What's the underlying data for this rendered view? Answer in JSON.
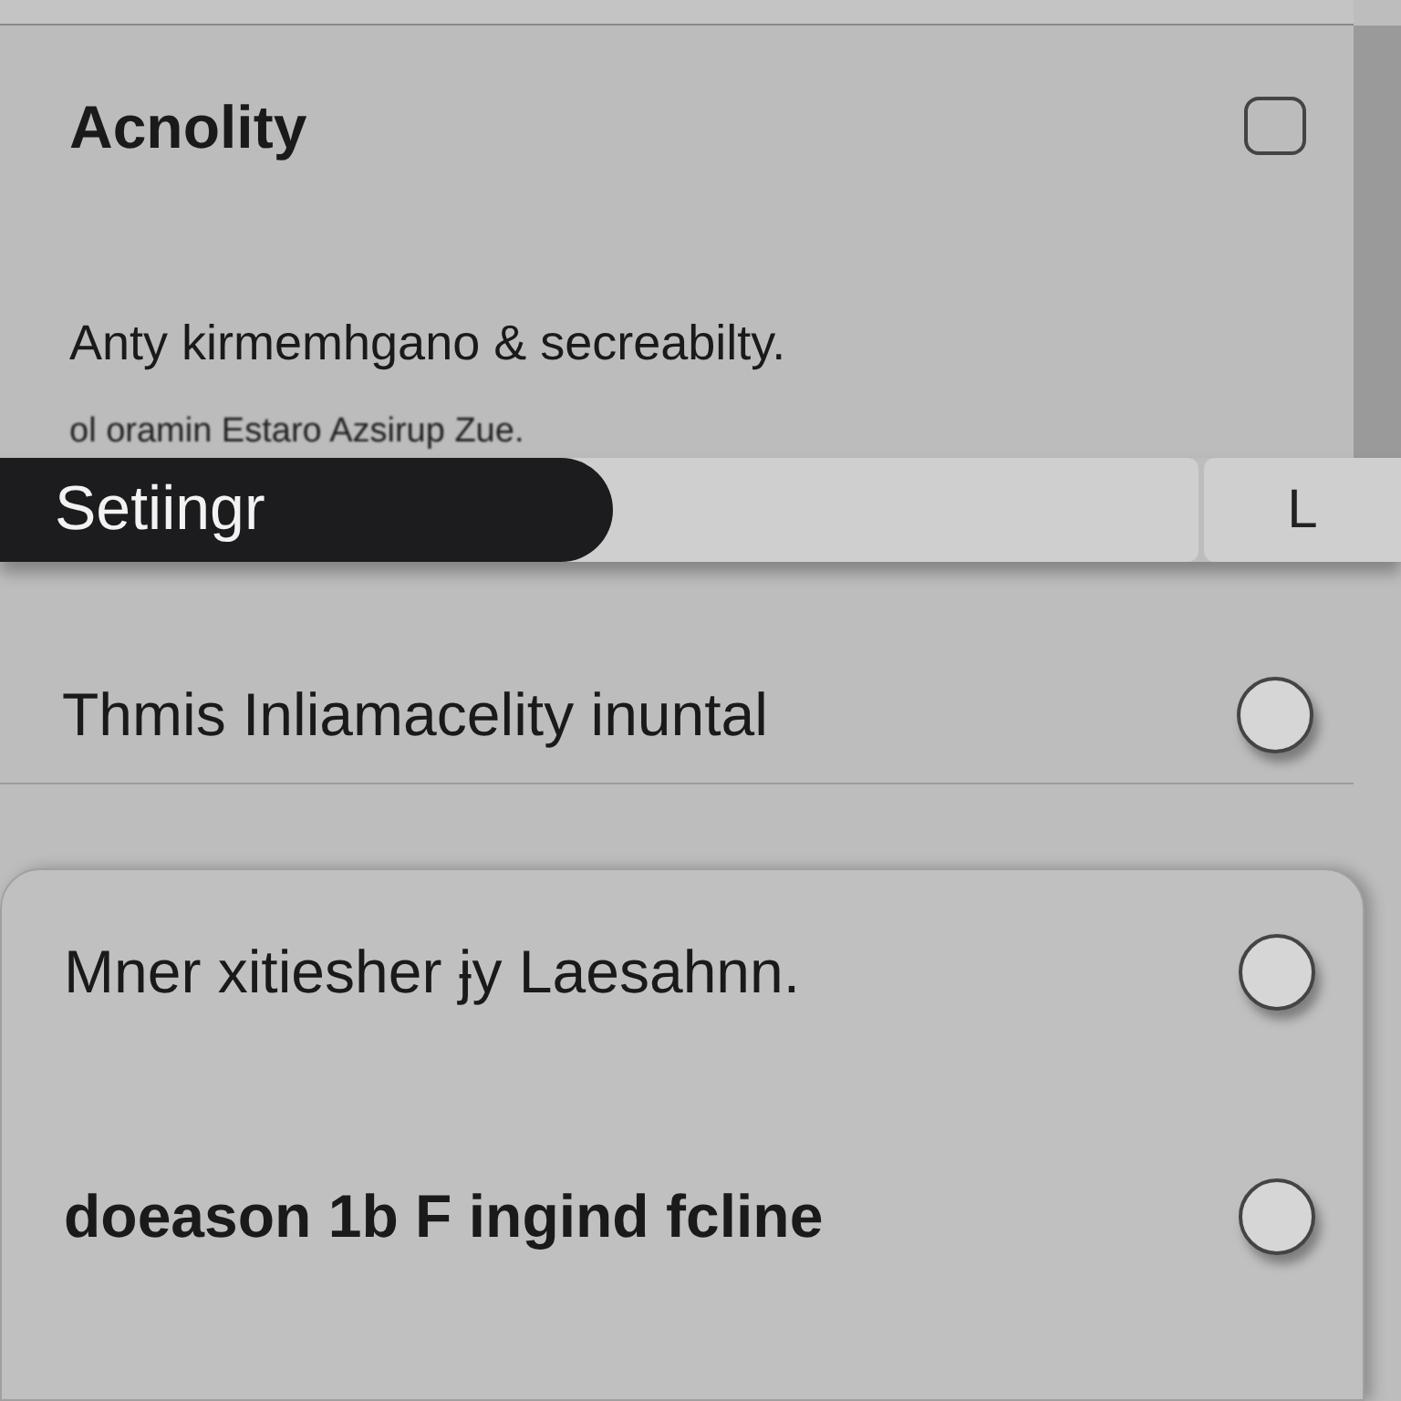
{
  "card": {
    "title": "Acnolity",
    "checked": false,
    "body": "Anty kirmemhgano & secreabilty.",
    "note": "ol oramin Estaro Azsirup Zue."
  },
  "toolbar": {
    "primary": "Setiingr",
    "secondary": "L"
  },
  "rows": [
    {
      "label": "Thmis Inliamacelity inuntal",
      "bold": false,
      "selected": false
    }
  ],
  "options": [
    {
      "label": "Mner xitiesher  ɉy Laesahnn.",
      "bold": false,
      "selected": false
    },
    {
      "label": "doeason 1b F ingind fcline",
      "bold": true,
      "selected": false
    }
  ]
}
